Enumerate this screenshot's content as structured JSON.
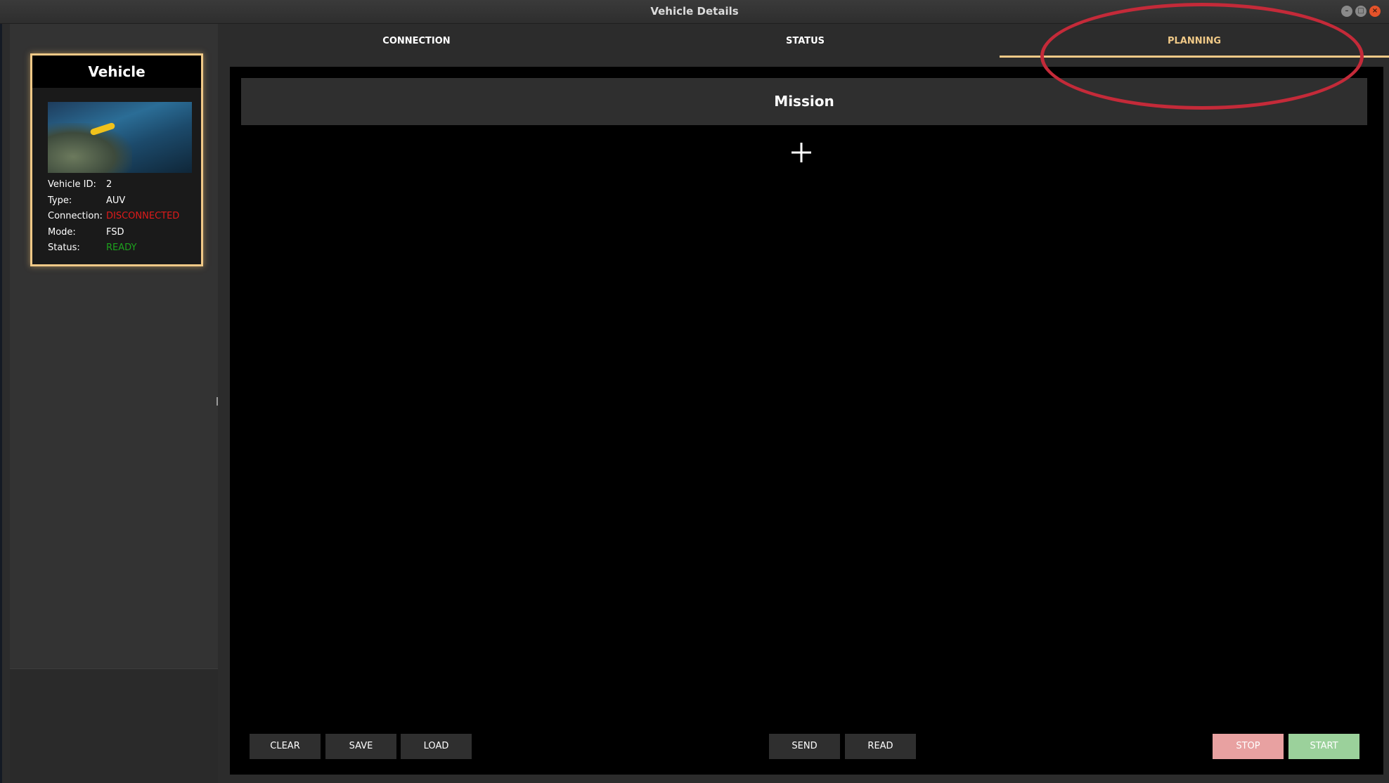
{
  "window": {
    "title": "Vehicle Details",
    "controls": [
      "minimize",
      "maximize",
      "close"
    ]
  },
  "vehicle_card": {
    "title": "Vehicle",
    "fields": [
      {
        "label": "Vehicle ID:",
        "value": "2"
      },
      {
        "label": "Type:",
        "value": "AUV"
      },
      {
        "label": "Connection:",
        "value": "DISCONNECTED"
      },
      {
        "label": "Mode:",
        "value": "FSD"
      },
      {
        "label": "Status:",
        "value": "READY"
      }
    ]
  },
  "tabs": [
    {
      "label": "CONNECTION",
      "active": false
    },
    {
      "label": "STATUS",
      "active": false
    },
    {
      "label": "PLANNING",
      "active": true
    }
  ],
  "mission": {
    "title": "Mission",
    "add_symbol": "+"
  },
  "buttons": {
    "clear": "CLEAR",
    "save": "SAVE",
    "load": "LOAD",
    "send": "SEND",
    "read": "READ",
    "stop": "STOP",
    "start": "START"
  },
  "colors": {
    "accent": "#f0c987",
    "disconnected": "#e01a1a",
    "ready": "#1da11d",
    "stop": "#e8a1a1",
    "start": "#9bd19b",
    "annotation": "#c42a39"
  }
}
